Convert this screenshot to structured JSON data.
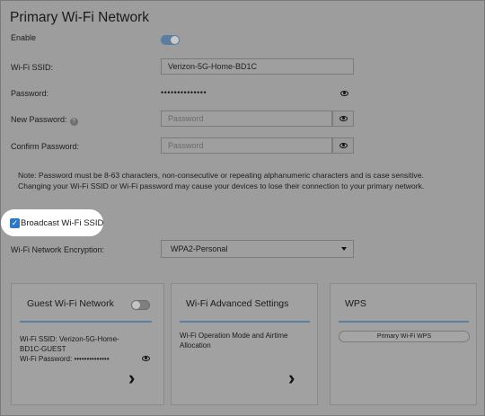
{
  "title": "Primary Wi-Fi Network",
  "enable_label": "Enable",
  "ssid_label": "Wi-Fi SSID:",
  "ssid_value": "Verizon-5G-Home-BD1C",
  "password_label": "Password:",
  "password_value": "••••••••••••••",
  "new_password_label": "New Password:",
  "new_password_placeholder": "Password",
  "confirm_password_label": "Confirm Password:",
  "confirm_password_placeholder": "Password",
  "note": "Note: Password must be 8-63 characters, non-consecutive or repeating alphanumeric characters and is case sensitive. Changing your Wi-Fi SSID or Wi-Fi password may cause your devices to lose their connection to your primary network.",
  "broadcast_label": "Broadcast Wi-Fi SSID",
  "encryption_label": "Wi-Fi Network Encryption:",
  "encryption_value": "WPA2-Personal",
  "help_glyph": "?",
  "check_glyph": "✓",
  "chevron_glyph": "›",
  "cards": {
    "guest": {
      "title": "Guest Wi-Fi Network",
      "ssid_line": "Wi-Fi SSID: Verizon-5G-Home-BD1C-GUEST",
      "password_line": "Wi-Fi Password: ••••••••••••••"
    },
    "advanced": {
      "title": "Wi-Fi Advanced Settings",
      "desc": "Wi-Fi Operation Mode and Airtime Allocation"
    },
    "wps": {
      "title": "WPS",
      "button": "Primary Wi-Fi WPS"
    }
  },
  "colors": {
    "accent": "#5b7ea0",
    "checkbox": "#2d78c4",
    "highlight": "#ffffff"
  }
}
